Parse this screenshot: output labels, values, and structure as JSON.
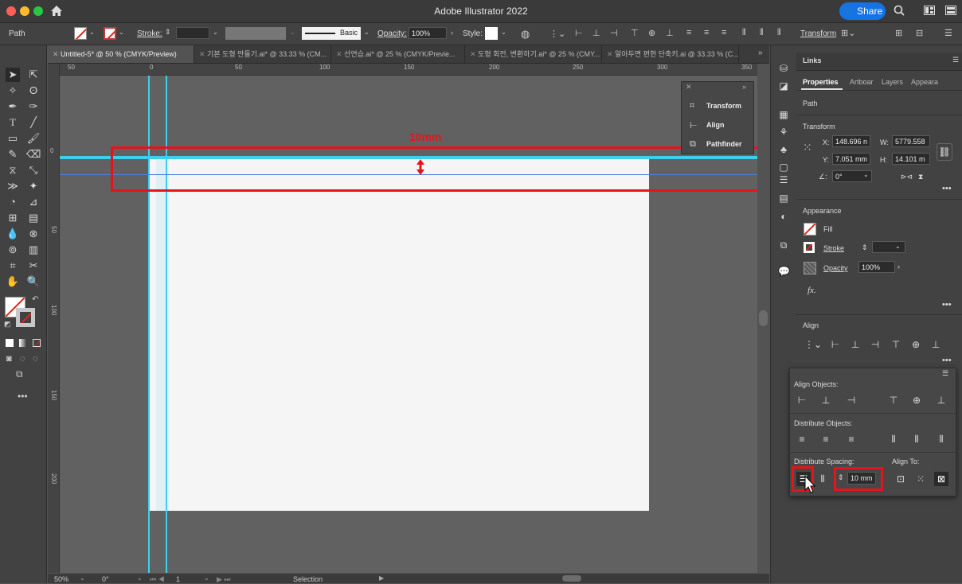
{
  "app": {
    "title": "Adobe Illustrator 2022",
    "share_label": "Share"
  },
  "control_bar": {
    "object_type": "Path",
    "stroke_label": "Stroke:",
    "brush_label": "Basic",
    "opacity_label": "Opacity:",
    "opacity_value": "100%",
    "style_label": "Style:",
    "transform_label": "Transform"
  },
  "tabs": [
    {
      "label": "Untitled-5* @ 50 % (CMYK/Preview)",
      "active": true
    },
    {
      "label": "기본 도형 만들기.ai* @ 33.33 % (CM..."
    },
    {
      "label": "선연습.ai* @ 25 % (CMYK/Previe..."
    },
    {
      "label": "도형 회전, 변환하기.ai* @ 25 % (CMY..."
    },
    {
      "label": "알아두면 편한 단축키.ai @ 33.33 % (C..."
    }
  ],
  "rulers": {
    "h_ticks": [
      "50",
      "0",
      "50",
      "100",
      "150",
      "200",
      "250",
      "300",
      "350"
    ],
    "v_ticks": [
      "0",
      "50",
      "100",
      "150",
      "200"
    ]
  },
  "canvas": {
    "annotation_label": "10mm"
  },
  "mini_panel": {
    "items": [
      "Transform",
      "Align",
      "Pathfinder"
    ]
  },
  "status": {
    "zoom": "50%",
    "rotation": "0°",
    "artboard": "1",
    "mode": "Selection"
  },
  "right_panel": {
    "panel_title": "Links",
    "tabs": [
      "Properties",
      "Artboar",
      "Layers",
      "Appeara"
    ],
    "object_type": "Path",
    "transform": {
      "heading": "Transform",
      "x_label": "X:",
      "x_value": "148.696 n",
      "y_label": "Y:",
      "y_value": "7.051 mm",
      "w_label": "W:",
      "w_value": "5779.558",
      "h_label": "H:",
      "h_value": "14.101 m",
      "angle_value": "0°"
    },
    "appearance": {
      "heading": "Appearance",
      "fill_label": "Fill",
      "stroke_label": "Stroke",
      "opacity_label": "Opacity",
      "opacity_value": "100%",
      "fx_label": "fx."
    },
    "align": {
      "heading": "Align"
    }
  },
  "align_popup": {
    "align_objects_label": "Align Objects:",
    "distribute_objects_label": "Distribute Objects:",
    "distribute_spacing_label": "Distribute Spacing:",
    "align_to_label": "Align To:",
    "spacing_value": "10 mm"
  },
  "colors": {
    "guide": "#3ecfee",
    "annotation": "#e5141b",
    "accent": "#1473e6"
  }
}
